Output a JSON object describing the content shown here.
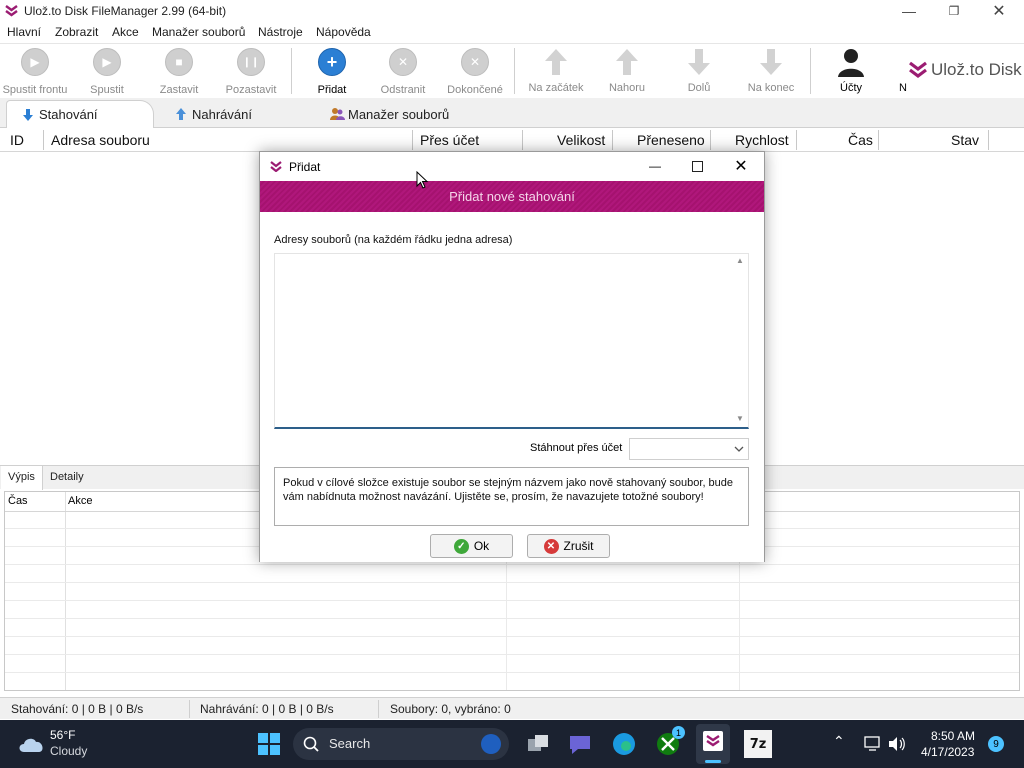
{
  "app": {
    "title": "Ulož.to Disk FileManager 2.99 (64-bit)"
  },
  "menu": [
    "Hlavní",
    "Zobrazit",
    "Akce",
    "Manažer souborů",
    "Nástroje",
    "Nápověda"
  ],
  "toolbar": {
    "start_queue": "Spustit frontu",
    "start": "Spustit",
    "stop": "Zastavit",
    "pause": "Pozastavit",
    "add": "Přidat",
    "remove": "Odstranit",
    "completed": "Dokončené",
    "to_start": "Na začátek",
    "up": "Nahoru",
    "down": "Dolů",
    "to_end": "Na konec",
    "accounts": "Účty",
    "overflow": "N",
    "brand": "Ulož.to Disk"
  },
  "tabs": [
    "Stahování",
    "Nahrávání",
    "Manažer souborů"
  ],
  "grid": {
    "columns": [
      "ID",
      "Adresa souboru",
      "Přes účet",
      "Velikost",
      "Přeneseno",
      "Rychlost",
      "Čas",
      "Stav"
    ]
  },
  "bottom_tabs": [
    "Výpis",
    "Detaily"
  ],
  "log": {
    "columns": [
      "Čas",
      "Akce"
    ]
  },
  "status": {
    "downloads": "Stahování: 0 | 0 B | 0 B/s",
    "uploads": "Nahrávání: 0 | 0 B | 0 B/s",
    "files": "Soubory: 0, vybráno: 0"
  },
  "dialog": {
    "title": "Přidat",
    "banner": "Přidat nové stahování",
    "addresses_label": "Adresy souborů (na každém řádku jedna adresa)",
    "addresses_value": "",
    "account_label": "Stáhnout přes účet",
    "account_value": "",
    "info": "Pokud v cílové složce existuje soubor se stejným názvem jako nově stahovaný soubor, bude vám nabídnuta možnost navázání. Ujistěte se, prosím, že navazujete totožné soubory!",
    "ok": "Ok",
    "cancel": "Zrušit"
  },
  "taskbar": {
    "temperature": "56°F",
    "weather": "Cloudy",
    "search": "Search",
    "xbox_badge": "1",
    "sevenzip": "7z",
    "time": "8:50 AM",
    "date": "4/17/2023",
    "notifications": "9"
  },
  "colors": {
    "accent": "#a8136f",
    "brand": "#9b1c72",
    "add_button": "#2b7fd4",
    "ok": "#3fa83a",
    "cancel": "#d63a3a"
  }
}
